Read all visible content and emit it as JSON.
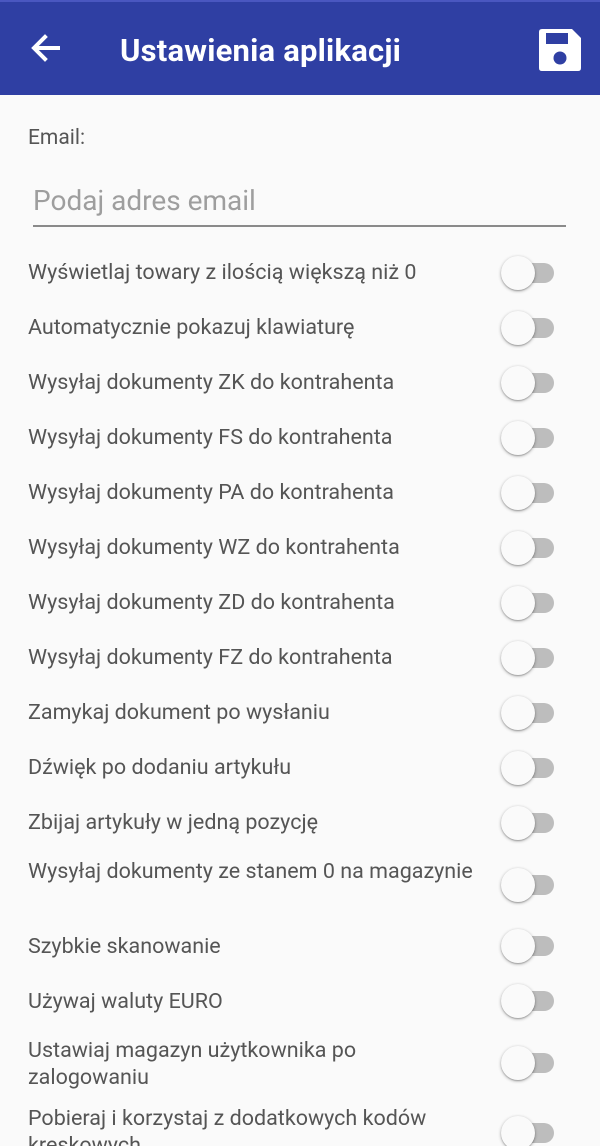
{
  "app_bar": {
    "title": "Ustawienia aplikacji",
    "back_icon": "arrow-back-icon",
    "save_icon": "floppy-disk-icon",
    "background_color": "#2f3fa3"
  },
  "email": {
    "label": "Email:",
    "placeholder": "Podaj adres email",
    "value": ""
  },
  "settings": [
    {
      "label": "Wyświetlaj towary z ilością większą niż 0",
      "enabled": false
    },
    {
      "label": "Automatycznie pokazuj klawiaturę",
      "enabled": false
    },
    {
      "label": "Wysyłaj dokumenty ZK do kontrahenta",
      "enabled": false
    },
    {
      "label": "Wysyłaj dokumenty FS do kontrahenta",
      "enabled": false
    },
    {
      "label": "Wysyłaj dokumenty PA do kontrahenta",
      "enabled": false
    },
    {
      "label": "Wysyłaj dokumenty WZ do kontrahenta",
      "enabled": false
    },
    {
      "label": "Wysyłaj dokumenty ZD do kontrahenta",
      "enabled": false
    },
    {
      "label": "Wysyłaj dokumenty FZ do kontrahenta",
      "enabled": false
    },
    {
      "label": "Zamykaj dokument po wysłaniu",
      "enabled": false
    },
    {
      "label": "Dźwięk po dodaniu artykułu",
      "enabled": false
    },
    {
      "label": "Zbijaj artykuły w jedną pozycję",
      "enabled": false
    },
    {
      "label": "Wysyłaj dokumenty ze stanem 0 na magazynie",
      "enabled": false
    },
    {
      "label": "Szybkie skanowanie",
      "enabled": false
    },
    {
      "label": "Używaj waluty EURO",
      "enabled": false
    },
    {
      "label": "Ustawiaj magazyn użytkownika po zalogowaniu",
      "enabled": false
    },
    {
      "label": "Pobieraj i korzystaj z dodatkowych kodów kreskowych",
      "enabled": false
    }
  ]
}
